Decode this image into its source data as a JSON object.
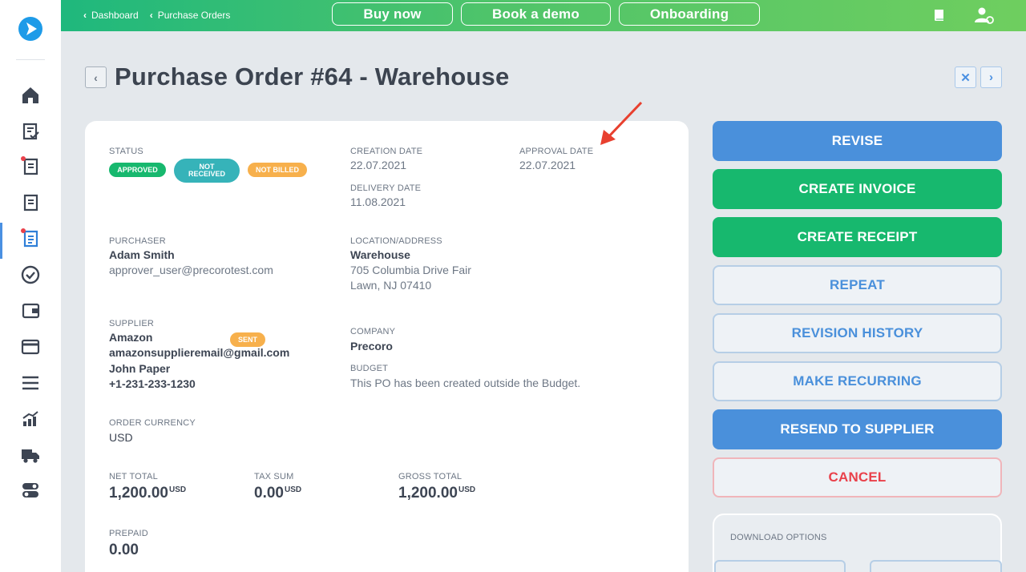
{
  "topbar": {
    "breadcrumbs": [
      "Dashboard",
      "Purchase Orders"
    ],
    "buttons": {
      "buy_now": "Buy now",
      "book_demo": "Book a demo",
      "onboarding": "Onboarding"
    }
  },
  "header": {
    "title": "Purchase Order #64 - Warehouse"
  },
  "card": {
    "status_label": "STATUS",
    "badges": {
      "approved": "APPROVED",
      "not_received": "NOT RECEIVED",
      "not_billed": "NOT BILLED"
    },
    "creation_date_label": "CREATION DATE",
    "creation_date": "22.07.2021",
    "approval_date_label": "APPROVAL DATE",
    "approval_date": "22.07.2021",
    "delivery_date_label": "DELIVERY DATE",
    "delivery_date": "11.08.2021",
    "purchaser_label": "PURCHASER",
    "purchaser_name": "Adam Smith",
    "purchaser_email": "approver_user@precorotest.com",
    "location_label": "LOCATION/ADDRESS",
    "location_name": "Warehouse",
    "location_line1": "705 Columbia Drive Fair",
    "location_line2": "Lawn, NJ 07410",
    "supplier_label": "SUPPLIER",
    "supplier_name": "Amazon",
    "supplier_badge": "SENT",
    "supplier_email": "amazonsupplieremail@gmail.com",
    "supplier_contact": "John Paper",
    "supplier_phone": "+1-231-233-1230",
    "company_label": "COMPANY",
    "company": "Precoro",
    "budget_label": "BUDGET",
    "budget": "This PO has been created outside the Budget.",
    "currency_label": "ORDER CURRENCY",
    "currency": "USD",
    "net_total_label": "NET TOTAL",
    "net_total": "1,200.00",
    "tax_sum_label": "TAX SUM",
    "tax_sum": "0.00",
    "gross_total_label": "GROSS TOTAL",
    "gross_total": "1,200.00",
    "currency_suffix": "USD",
    "prepaid_label": "PREPAID",
    "prepaid": "0.00"
  },
  "actions": {
    "revise": "REVISE",
    "create_invoice": "CREATE INVOICE",
    "create_receipt": "CREATE RECEIPT",
    "repeat": "REPEAT",
    "revision_history": "REVISION HISTORY",
    "make_recurring": "MAKE RECURRING",
    "resend": "RESEND TO SUPPLIER",
    "cancel": "CANCEL",
    "download_options": "DOWNLOAD OPTIONS"
  },
  "colors": {
    "brand_green": "#17b86e",
    "brand_blue": "#4a90db",
    "danger": "#e9414b",
    "badge_teal": "#36b3b9",
    "badge_orange": "#f7b04c"
  },
  "icons": {
    "sidebar": [
      "home-icon",
      "approval-list-icon",
      "requests-icon",
      "documents-icon",
      "purchase-orders-icon",
      "check-circle-icon",
      "wallet-icon",
      "payment-card-icon",
      "menu-icon",
      "analytics-icon",
      "truck-icon",
      "toggle-settings-icon"
    ],
    "topbar": [
      "book-icon",
      "user-settings-icon"
    ]
  }
}
